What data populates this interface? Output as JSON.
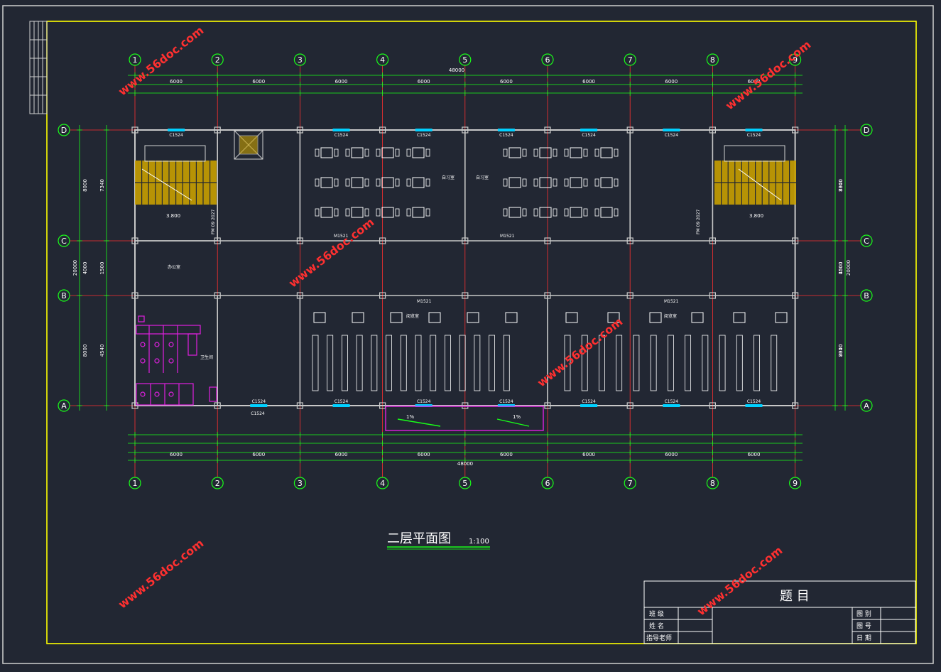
{
  "drawing": {
    "title": "二层平面图",
    "scale": "1:100",
    "total_length": "48000",
    "total_depth": "20000",
    "axes_numeric": [
      "1",
      "2",
      "3",
      "4",
      "5",
      "6",
      "7",
      "8",
      "9"
    ],
    "axes_letter": [
      "A",
      "B",
      "C",
      "D"
    ],
    "bay_label": "6000",
    "left_dims_outer": [
      "8000",
      "4000",
      "8000"
    ],
    "left_dims_inner": [
      "7340",
      "1500",
      "4540"
    ],
    "right_dims_outer": [
      "8000",
      "4000",
      "8000"
    ],
    "right_dims_inner": [
      "7340",
      "1500",
      "7340"
    ],
    "window_tag": "C1524",
    "door_tag": "M1521",
    "fire_door_tag": "FM 09 2027",
    "elevation": "3.800",
    "slope": "1%",
    "room_classroom": "自习室",
    "room_office": "办公室",
    "room_reading": "阅览室",
    "room_toilet": "卫生间",
    "watermark": "www.56doc.com"
  },
  "title_block": {
    "subject": "题  目",
    "class_label": "班  级",
    "name_label": "姓  名",
    "advisor_label": "指导老师",
    "sheet_label": "图  别",
    "number_label": "图  号",
    "date_label": "日  期"
  },
  "colors": {
    "background": "#222733",
    "frame": "#ffff00",
    "axis": "#ff3030",
    "dimension": "#19ff19",
    "wall": "#c8c8c8",
    "window": "#00d0ff",
    "sanitary": "#e020e0"
  }
}
